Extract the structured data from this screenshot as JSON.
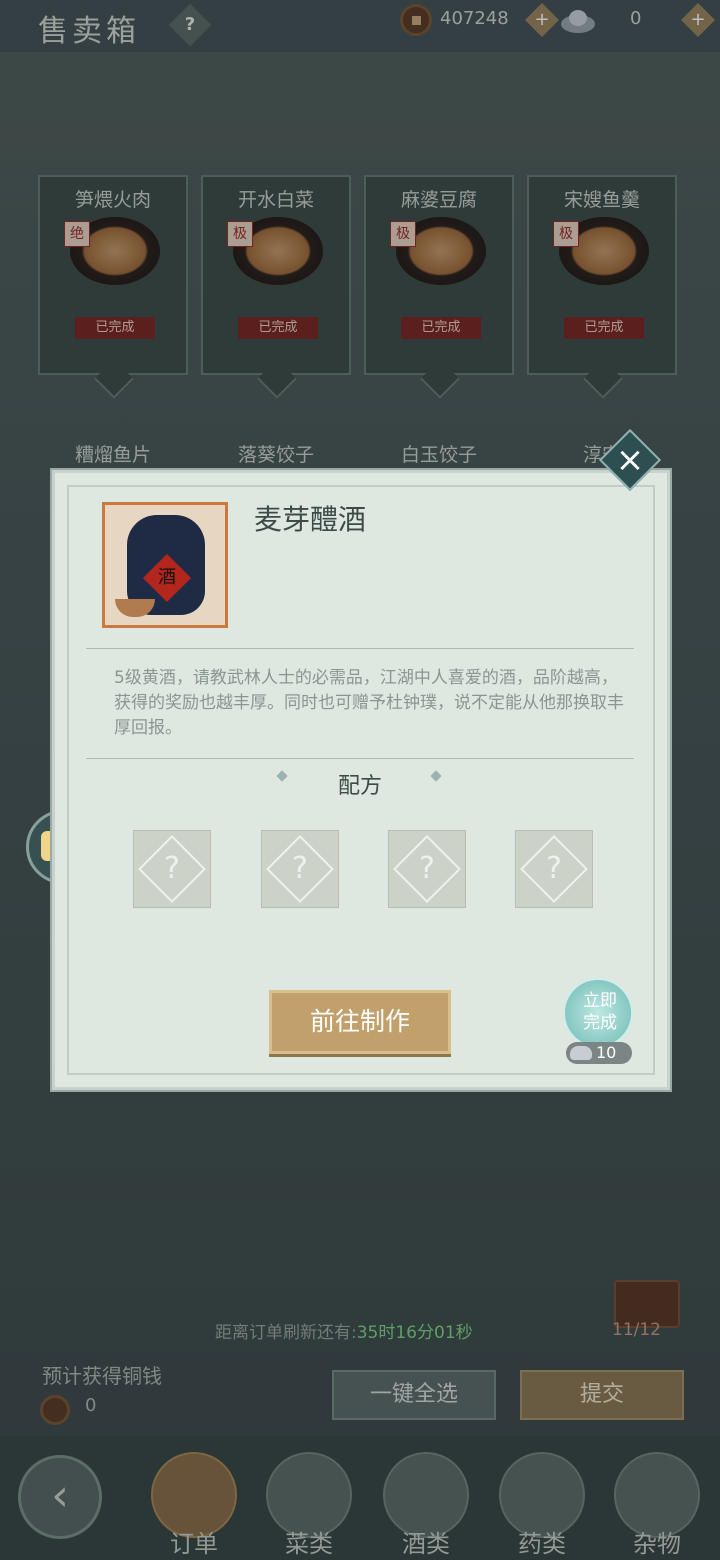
{
  "header": {
    "title": "售卖箱",
    "help": "?",
    "coins": "407248",
    "silver": "0",
    "plus": "+"
  },
  "orders": [
    {
      "name": "笋煨火肉",
      "grade": "绝",
      "status": "已完成"
    },
    {
      "name": "开水白菜",
      "grade": "极",
      "status": "已完成"
    },
    {
      "name": "麻婆豆腐",
      "grade": "极",
      "status": "已完成"
    },
    {
      "name": "宋嫂鱼羹",
      "grade": "极",
      "status": "已完成"
    }
  ],
  "orders_row2": [
    "糟熘鱼片",
    "落葵饺子",
    "白玉饺子",
    "淳安"
  ],
  "modal": {
    "close": "×",
    "item_name": "麦芽醴酒",
    "item_label": "酒",
    "description": "5级黄酒，请教武林人士的必需品，江湖中人喜爱的酒，品阶越高，获得的奖励也越丰厚。同时也可赠予杜钟璞，说不定能从他那换取丰厚回报。",
    "recipe_title": "配方",
    "slots": [
      "?",
      "?",
      "?",
      "?"
    ],
    "make_button": "前往制作",
    "instant_label": "立即完成",
    "instant_cost": "10"
  },
  "footer": {
    "refresh_label": "距离订单刷新还有:",
    "refresh_time": "35时16分01秒",
    "chest_count": "11/12",
    "estimate_label": "预计获得铜钱",
    "estimate_value": "0",
    "select_all": "一键全选",
    "submit": "提交"
  },
  "nav": {
    "back": "‹",
    "tabs": [
      "订单",
      "菜类",
      "酒类",
      "药类",
      "杂物"
    ],
    "active": "订单"
  }
}
